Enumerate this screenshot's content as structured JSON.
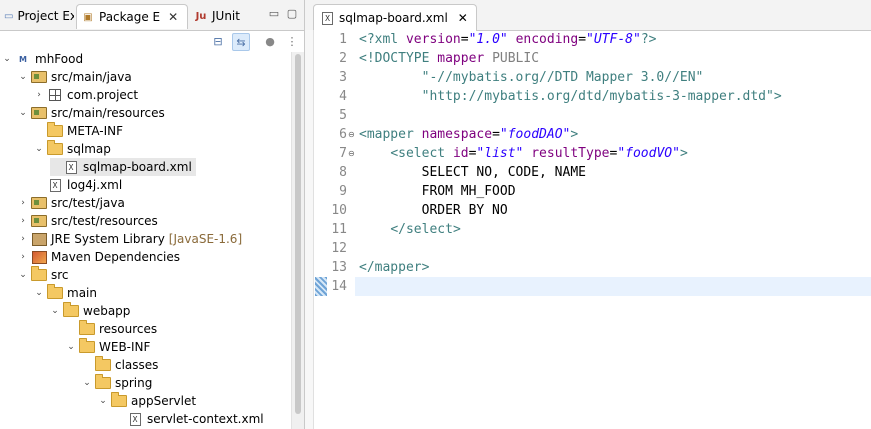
{
  "left_panel": {
    "tabs": [
      {
        "label": "Project Ex"
      },
      {
        "label": "Package E"
      },
      {
        "label": "JUnit"
      }
    ],
    "tree": [
      {
        "label": "mhFood",
        "icon": "maven-project-icon",
        "expanded": true,
        "level": 0
      },
      {
        "label": "src/main/java",
        "icon": "source-folder-icon",
        "expanded": true,
        "level": 1
      },
      {
        "label": "com.project",
        "icon": "package-icon",
        "expanded": false,
        "level": 2
      },
      {
        "label": "src/main/resources",
        "icon": "source-folder-icon",
        "expanded": true,
        "level": 1
      },
      {
        "label": "META-INF",
        "icon": "folder-icon",
        "level": 2
      },
      {
        "label": "sqlmap",
        "icon": "folder-icon",
        "expanded": true,
        "level": 2
      },
      {
        "label": "sqlmap-board.xml",
        "icon": "xml-file-icon",
        "level": 3,
        "selected": true
      },
      {
        "label": "log4j.xml",
        "icon": "xml-file-icon",
        "level": 2
      },
      {
        "label": "src/test/java",
        "icon": "source-folder-icon",
        "expanded": false,
        "level": 1
      },
      {
        "label": "src/test/resources",
        "icon": "source-folder-icon",
        "expanded": false,
        "level": 1
      },
      {
        "label": "JRE System Library",
        "decoration": "[JavaSE-1.6]",
        "icon": "library-icon",
        "expanded": false,
        "level": 1
      },
      {
        "label": "Maven Dependencies",
        "icon": "library-icon",
        "expanded": false,
        "level": 1
      },
      {
        "label": "src",
        "icon": "folder-icon",
        "expanded": true,
        "level": 1
      },
      {
        "label": "main",
        "icon": "folder-icon",
        "expanded": true,
        "level": 2
      },
      {
        "label": "webapp",
        "icon": "folder-icon",
        "expanded": true,
        "level": 3
      },
      {
        "label": "resources",
        "icon": "folder-icon",
        "level": 4
      },
      {
        "label": "WEB-INF",
        "icon": "folder-icon",
        "expanded": true,
        "level": 4
      },
      {
        "label": "classes",
        "icon": "folder-icon",
        "level": 5
      },
      {
        "label": "spring",
        "icon": "folder-icon",
        "expanded": true,
        "level": 5
      },
      {
        "label": "appServlet",
        "icon": "folder-icon",
        "expanded": true,
        "level": 6
      },
      {
        "label": "servlet-context.xml",
        "icon": "xml-file-icon",
        "level": 7
      }
    ]
  },
  "editor": {
    "tab_label": "sqlmap-board.xml",
    "current_line": 14,
    "lines": [
      {
        "n": "1",
        "text": "<?xml version=\"1.0\" encoding=\"UTF-8\"?>"
      },
      {
        "n": "2",
        "text": "<!DOCTYPE mapper PUBLIC"
      },
      {
        "n": "3",
        "text": "        \"-//mybatis.org//DTD Mapper 3.0//EN\""
      },
      {
        "n": "4",
        "text": "        \"http://mybatis.org/dtd/mybatis-3-mapper.dtd\">"
      },
      {
        "n": "5",
        "text": ""
      },
      {
        "n": "6",
        "text": "<mapper namespace=\"foodDAO\">"
      },
      {
        "n": "7",
        "text": "    <select id=\"list\" resultType=\"foodVO\">"
      },
      {
        "n": "8",
        "text": "        SELECT NO, CODE, NAME"
      },
      {
        "n": "9",
        "text": "        FROM MH_FOOD"
      },
      {
        "n": "10",
        "text": "        ORDER BY NO"
      },
      {
        "n": "11",
        "text": "    </select>"
      },
      {
        "n": "12",
        "text": ""
      },
      {
        "n": "13",
        "text": "</mapper>"
      },
      {
        "n": "14",
        "text": ""
      }
    ]
  },
  "colors": {
    "tag": "#3f7f7f",
    "attr": "#7f007f",
    "value": "#2a00ff",
    "current_line": "#e8f2fe"
  }
}
